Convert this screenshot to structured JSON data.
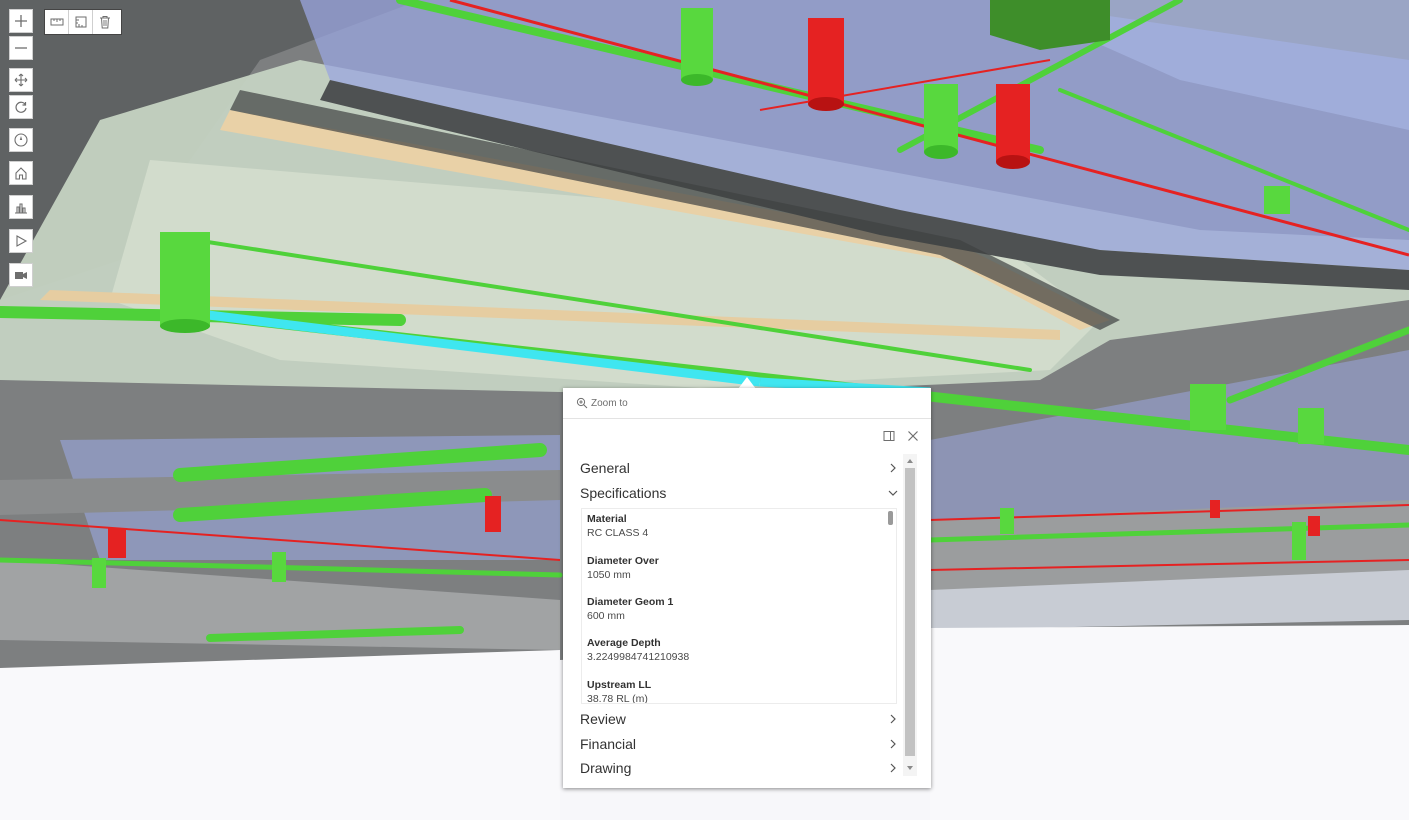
{
  "toolbar": {
    "zoom_in": "zoom-in-icon",
    "zoom_out": "zoom-out-icon",
    "pan": "pan-icon",
    "rotate": "rotate-icon",
    "compass": "compass-icon",
    "home": "home-icon",
    "daylight": "daylight-icon",
    "play": "play-icon",
    "camera": "camera-icon"
  },
  "sketch_toolbar": [
    "line-measure-icon",
    "area-measure-icon",
    "trash-icon"
  ],
  "popup": {
    "zoom_to_label": "Zoom to",
    "sections": [
      {
        "label": "General",
        "expanded": false
      },
      {
        "label": "Specifications",
        "expanded": true
      },
      {
        "label": "Review",
        "expanded": false
      },
      {
        "label": "Financial",
        "expanded": false
      },
      {
        "label": "Drawing",
        "expanded": false
      }
    ],
    "fields": [
      {
        "label": "Material",
        "value": "RC CLASS 4"
      },
      {
        "label": "Diameter Over",
        "value": "1050 mm"
      },
      {
        "label": "Diameter Geom 1",
        "value": "600 mm"
      },
      {
        "label": "Average Depth",
        "value": "3.2249984741210938"
      },
      {
        "label": "Upstream LL",
        "value": "38.78 RL (m)"
      }
    ]
  },
  "colors": {
    "pipe_green": "#4fd13a",
    "pipe_red": "#e52222",
    "highlight_cyan": "#3fe6f0",
    "glass_blue": "#8f9fe0",
    "ground_white": "#f7f7fa"
  }
}
